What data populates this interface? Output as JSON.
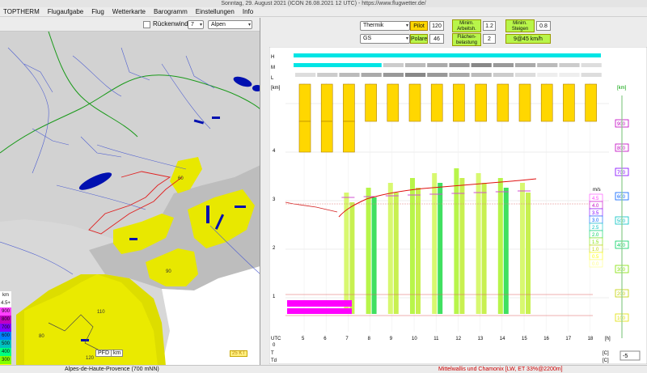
{
  "window": {
    "title": "Sonntag, 29. August 2021 (ICON 26.08.2021 12 UTC) - https://www.flugwetter.de/"
  },
  "menu": [
    "TOPTHERM",
    "Flugaufgabe",
    "Flug",
    "Wetterkarte",
    "Barogramm",
    "Einstellungen",
    "Info"
  ],
  "map": {
    "rueckenwind_label": "Rückenwind",
    "level_value": "7",
    "region_value": "Alpen",
    "pfd_label": "PFD",
    "km_label": "km",
    "wind_label": "25 KT",
    "contour_labels": [
      "60",
      "90",
      "110",
      "80",
      "120"
    ],
    "legend_left": [
      {
        "label": "km",
        "color": "#ffffff"
      },
      {
        "label": "4.5+",
        "color": "#ffffff"
      },
      {
        "label": "900",
        "color": "#ff40ff"
      },
      {
        "label": "800",
        "color": "#c000c0"
      },
      {
        "label": "700",
        "color": "#8000ff"
      },
      {
        "label": "600",
        "color": "#0080ff"
      },
      {
        "label": "500",
        "color": "#00c0c0"
      },
      {
        "label": "400",
        "color": "#00ff80"
      },
      {
        "label": "300",
        "color": "#80ff00"
      },
      {
        "label": "200",
        "color": "#ffff00"
      },
      {
        "label": "100",
        "color": "#ffff80"
      }
    ]
  },
  "controls": {
    "mode_value": "Thermik",
    "glider_value": "GS",
    "pilot_label": "Pilot",
    "pilot_value": "120",
    "polare_label": "Polare",
    "polare_value": "46",
    "min_arbeit_label": "Minim. Arbeitsh.",
    "min_arbeit_value": "1.2",
    "min_steigen_label": "Minim. Steigen",
    "min_steigen_value": "0.8",
    "flaechen_label": "Flächen- belastung",
    "flaechen_value": "2",
    "speed_value": "9@45 km/h"
  },
  "meteogram": {
    "hours": [
      "5",
      "6",
      "7",
      "8",
      "9",
      "10",
      "11",
      "12",
      "13",
      "14",
      "15",
      "16",
      "17",
      "18"
    ],
    "utc_label": "UTC",
    "h_label": "[h]",
    "km_axis_label": "[km]",
    "left_km_ticks": [
      "4",
      "3",
      "2",
      "1",
      "0"
    ],
    "right_m_ticks": [
      "900",
      "800",
      "700",
      "600",
      "500",
      "400",
      "300",
      "200",
      "100"
    ],
    "right_m_colors": [
      "#c000c0",
      "#c000c0",
      "#8000ff",
      "#0060ff",
      "#00c0c0",
      "#00d060",
      "#80e000",
      "#c0d000",
      "#e0e000"
    ],
    "row_labels": {
      "H": "H",
      "M": "M",
      "L": "L",
      "T": "T",
      "Td": "Td"
    },
    "unit_c": "[C]",
    "ms_label": "m/s",
    "ms_scale": [
      {
        "label": "4.5",
        "color": "#ff40ff"
      },
      {
        "label": "4.0",
        "color": "#c000c0"
      },
      {
        "label": "3.5",
        "color": "#8000ff"
      },
      {
        "label": "3.0",
        "color": "#0060ff"
      },
      {
        "label": "2.5",
        "color": "#00c0c0"
      },
      {
        "label": "2.0",
        "color": "#00d060"
      },
      {
        "label": "1.5",
        "color": "#80e000"
      },
      {
        "label": "1.0",
        "color": "#c0d000"
      },
      {
        "label": "0.5",
        "color": "#ffff00"
      },
      {
        "label": "0.0",
        "color": "#ffff80"
      }
    ],
    "offset_value": "-5"
  },
  "status": {
    "left": "Alpes-de-Haute-Provence (700 mNN)",
    "right": "Mittelwallis und Chamonix [LW, ET   33%@2200m]"
  },
  "colors": {
    "accent_yellow": "#ffd700",
    "accent_green": "#b8f54a",
    "cyan_bar": "#00e5e5",
    "magenta": "#ff00ff"
  }
}
